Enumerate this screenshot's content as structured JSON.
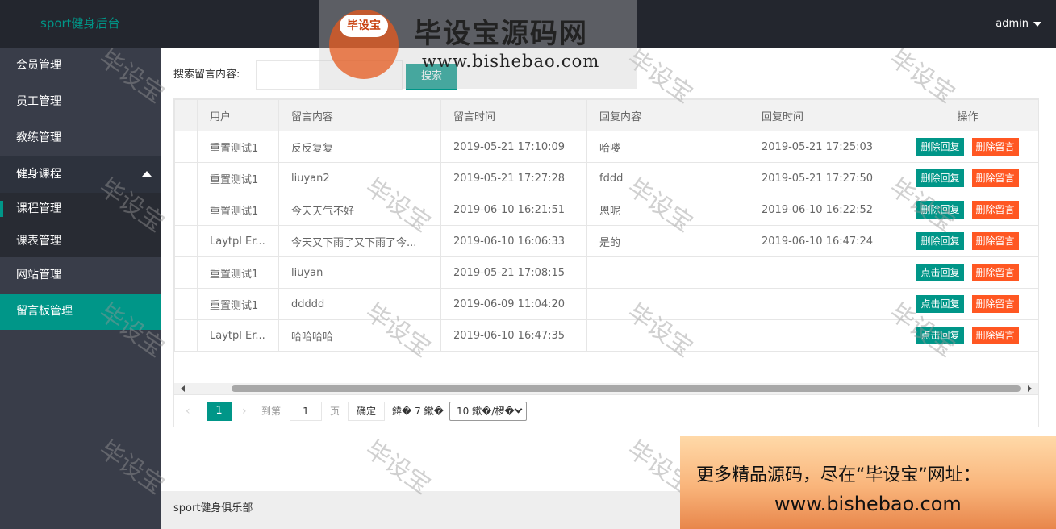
{
  "app": {
    "title": "sport健身后台",
    "user": "admin"
  },
  "sidebar": {
    "items": [
      {
        "label": "会员管理"
      },
      {
        "label": "员工管理"
      },
      {
        "label": "教练管理"
      },
      {
        "label": "健身课程"
      },
      {
        "label": "网站管理"
      },
      {
        "label": "留言板管理"
      }
    ],
    "sub": [
      {
        "label": "课程管理"
      },
      {
        "label": "课表管理"
      }
    ]
  },
  "search": {
    "label": "搜索留言内容:",
    "value": "",
    "button": "搜索"
  },
  "table": {
    "headers": [
      "用户",
      "留言内容",
      "留言时间",
      "回复内容",
      "回复时间",
      "操作"
    ],
    "rows": [
      {
        "user": "重置测试1",
        "content": "反反复复",
        "time": "2019-05-21 17:10:09",
        "reply": "哈喽",
        "reply_time": "2019-05-21 17:25:03",
        "action1": "删除回复",
        "action2": "删除留言"
      },
      {
        "user": "重置测试1",
        "content": "liuyan2",
        "time": "2019-05-21 17:27:28",
        "reply": "fddd",
        "reply_time": "2019-05-21 17:27:50",
        "action1": "删除回复",
        "action2": "删除留言"
      },
      {
        "user": "重置测试1",
        "content": "今天天气不好",
        "time": "2019-06-10 16:21:51",
        "reply": "恩呢",
        "reply_time": "2019-06-10 16:22:52",
        "action1": "删除回复",
        "action2": "删除留言"
      },
      {
        "user": "Laytpl Er...",
        "content": "今天又下雨了又下雨了今...",
        "time": "2019-06-10 16:06:33",
        "reply": "是的",
        "reply_time": "2019-06-10 16:47:24",
        "action1": "删除回复",
        "action2": "删除留言"
      },
      {
        "user": "重置测试1",
        "content": "liuyan",
        "time": "2019-05-21 17:08:15",
        "reply": "",
        "reply_time": "",
        "action1": "点击回复",
        "action2": "删除留言"
      },
      {
        "user": "重置测试1",
        "content": "ddddd",
        "time": "2019-06-09 11:04:20",
        "reply": "",
        "reply_time": "",
        "action1": "点击回复",
        "action2": "删除留言"
      },
      {
        "user": "Laytpl Er...",
        "content": "哈哈哈哈",
        "time": "2019-06-10 16:47:35",
        "reply": "",
        "reply_time": "",
        "action1": "点击回复",
        "action2": "删除留言"
      }
    ]
  },
  "pager": {
    "current": "1",
    "goto_label": "到第",
    "page_input": "1",
    "page_unit": "页",
    "confirm": "确定",
    "count": "鍏� 7 鏉�",
    "page_size": "10 鏉�/椤�"
  },
  "footer": {
    "text": "sport健身俱乐部"
  },
  "watermark": {
    "text": "毕设宝"
  },
  "banner": {
    "badge": "毕设宝",
    "title": "毕设宝源码网",
    "url": "www.bishebao.com"
  },
  "ad": {
    "line1": "更多精品源码，尽在“毕设宝”网址：",
    "line2": "www.bishebao.com"
  }
}
